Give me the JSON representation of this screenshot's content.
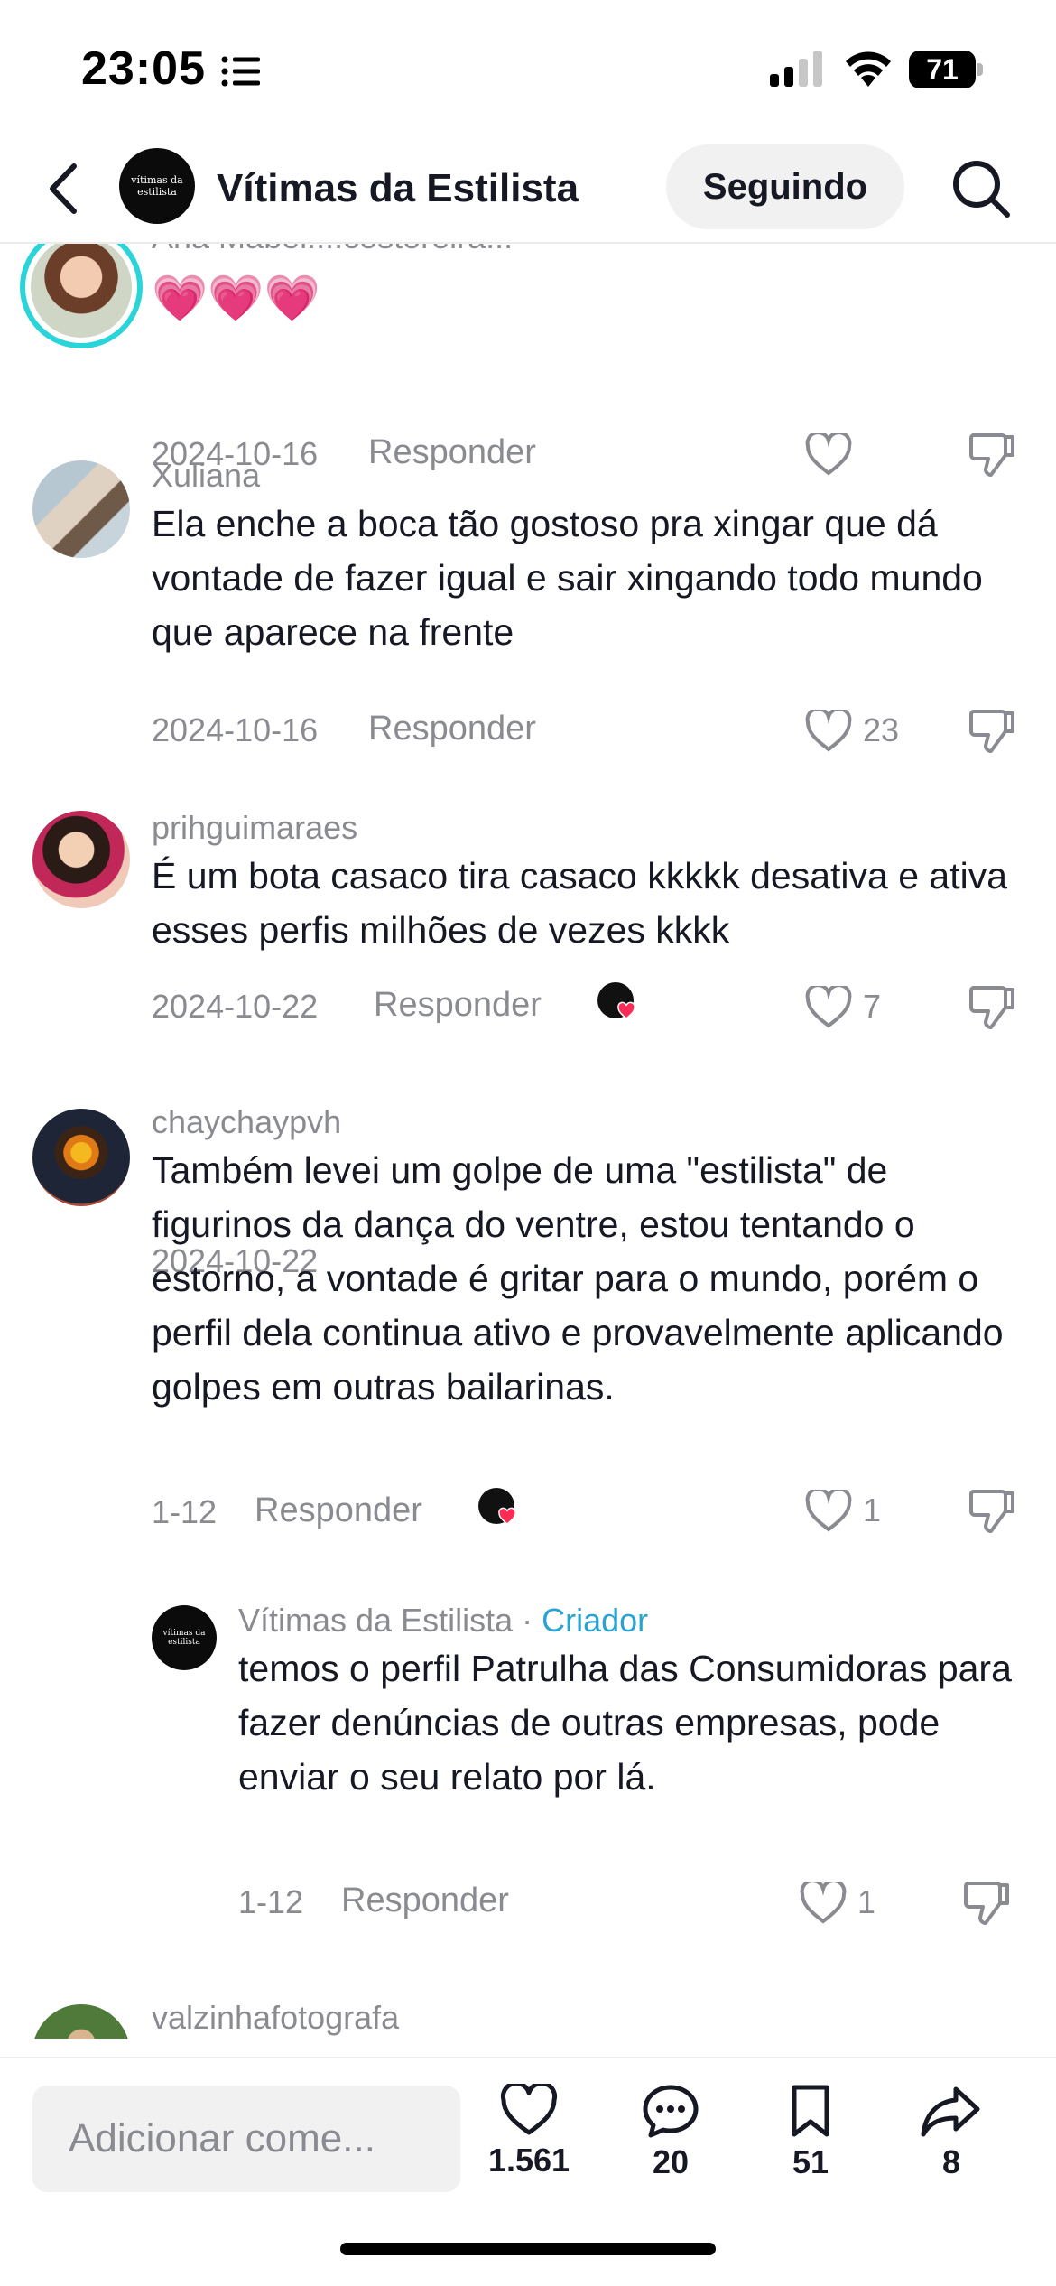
{
  "status_bar": {
    "time": "23:05",
    "battery": "71"
  },
  "header": {
    "title": "Vítimas da Estilista",
    "avatar_text": "vítimas da estilista",
    "follow_label": "Seguindo"
  },
  "comments": [
    {
      "user": "Ana Mabel....costoreira...",
      "text": "💗💗💗",
      "date": "2024-10-16",
      "reply_label": "Responder",
      "likes": ""
    },
    {
      "user": "Xuliana",
      "text": "Ela enche a boca tão gostoso pra xingar que dá vontade de fazer igual e sair xingando todo mundo que aparece na frente",
      "date": "2024-10-16",
      "reply_label": "Responder",
      "likes": "23"
    },
    {
      "user": "prihguimaraes",
      "text": "É um bota casaco tira casaco kkkkk desativa e ativa esses perfis milhões de vezes kkkk",
      "date": "2024-10-22",
      "reply_label": "Responder",
      "likes": "7"
    },
    {
      "user": "chaychaypvh",
      "text": "Também levei um golpe de uma \"estilista\" de figurinos da dança do ventre, estou tentando o estorno, a vontade é gritar para o mundo, porém o perfil dela continua ativo e provavelmente aplicando golpes em outras bailarinas.",
      "date": "1-12",
      "reply_label": "Responder",
      "likes": "1"
    },
    {
      "user": "Vítimas da Estilista",
      "separator": " · ",
      "creator_tag": "Criador",
      "text": "temos o perfil Patrulha das Consumidoras para fazer denúncias de outras empresas, pode enviar o seu relato por lá.",
      "date": "1-12",
      "reply_label": "Responder",
      "likes": "1"
    },
    {
      "user": "valzinhafotografa"
    }
  ],
  "bottom_bar": {
    "input_placeholder": "Adicionar come...",
    "likes": "1.561",
    "comments": "20",
    "saves": "51",
    "shares": "8"
  },
  "colors": {
    "creator_tag": "#2aa3d0",
    "muted": "#8a8b91",
    "text": "#161823"
  }
}
